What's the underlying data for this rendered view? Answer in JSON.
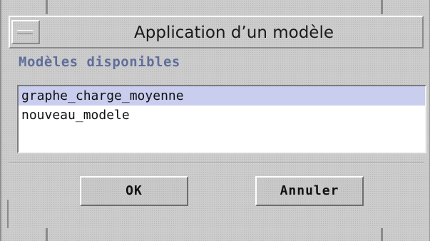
{
  "dialog": {
    "title": "Application d’un modèle",
    "section_label": "Modèles disponibles",
    "templates": [
      {
        "label": "graphe_charge_moyenne",
        "selected": true
      },
      {
        "label": "nouveau_modele",
        "selected": false
      }
    ],
    "ok_label": "OK",
    "cancel_label": "Annuler"
  },
  "colors": {
    "background": "#cccccc",
    "selection": "#c9cdee",
    "section_label": "#5e6e9c"
  },
  "icons": {
    "window_menu": "window-menu-icon"
  }
}
